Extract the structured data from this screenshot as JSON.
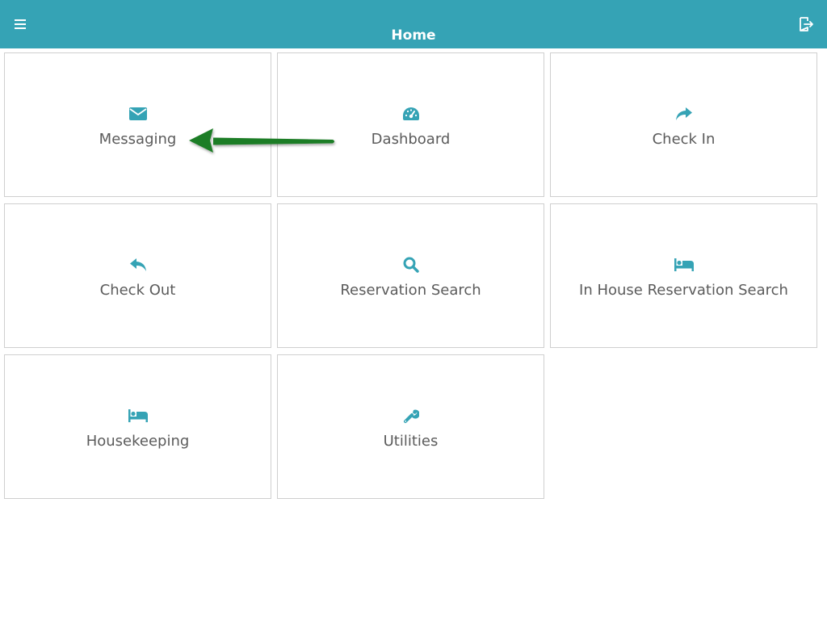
{
  "header": {
    "title": "Home",
    "menu_icon": "hamburger-menu-icon",
    "logout_icon": "sign-out-icon",
    "bg_color": "#35a3b5"
  },
  "tiles": [
    {
      "label": "Messaging",
      "icon": "envelope-icon"
    },
    {
      "label": "Dashboard",
      "icon": "dashboard-gauge-icon"
    },
    {
      "label": "Check In",
      "icon": "share-arrow-icon"
    },
    {
      "label": "Check Out",
      "icon": "reply-arrow-icon"
    },
    {
      "label": "Reservation Search",
      "icon": "search-icon"
    },
    {
      "label": "In House Reservation Search",
      "icon": "bed-icon"
    },
    {
      "label": "Housekeeping",
      "icon": "bed-icon"
    },
    {
      "label": "Utilities",
      "icon": "wrench-icon"
    }
  ],
  "colors": {
    "accent": "#35a3b5",
    "tile_text": "#5b5b5b",
    "tile_border": "#cfcfcf",
    "annotation_arrow": "#1e7d26"
  }
}
